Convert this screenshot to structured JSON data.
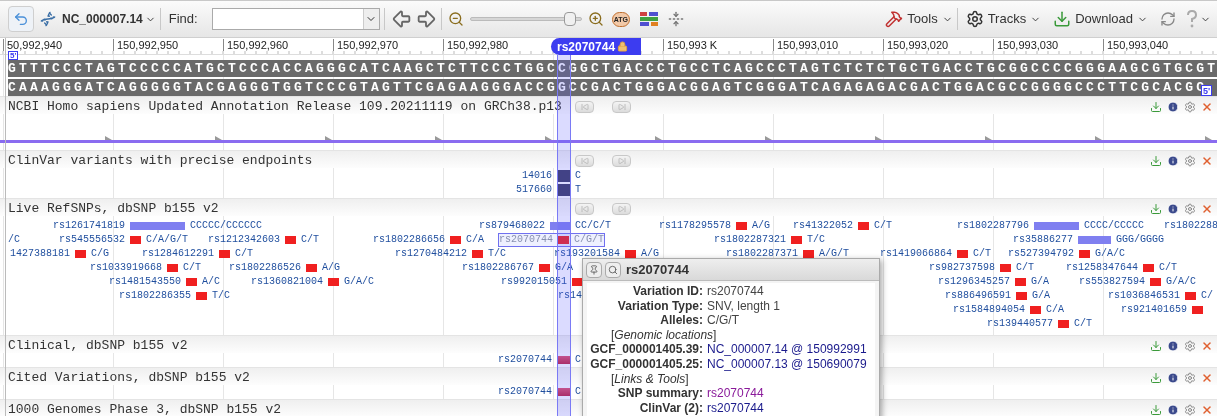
{
  "toolbar": {
    "sequence": "NC_000007.14",
    "find_label": "Find:",
    "level": 0.9,
    "sequence_button": "ATG",
    "menus": [
      "Tools",
      "Tracks",
      "Download"
    ]
  },
  "ruler": {
    "ticks": [
      "50,992,940",
      "150,992,950",
      "150,992,960",
      "150,992,970",
      "150,992,980",
      "150,993 K",
      "150,993,010",
      "150,993,020",
      "150,993,030",
      "150,993,040"
    ],
    "marker": "rs2070744"
  },
  "sequence": {
    "start_label": "5'",
    "forward": "GTTTCCCTAGTCCCCCATGCTCCCACCAGGGCATCAAGCTCTTCCCTGGCCGGCTGACCCTGCCTCAGCCCTAGTCTCTCTGCTGACCTGCGGCCCCGGGAAGCGTGCGT",
    "reverse": "CAAAGGGATCAGGGGGTACGAGGGTGGTCCCGTAGTTCGAGAAGGGACCGGCCGACTGGGACGGAGTCGGGATCAGAGAGACGACTGGACGCCGGGGCCCTTCGCACGC",
    "end_label": "5'"
  },
  "tracks": [
    {
      "kind": "gene",
      "title": "NCBI Homo sapiens Updated Annotation Release 109.20211119 on GRCh38.p13"
    },
    {
      "kind": "clinvar",
      "title": "ClinVar variants with precise endpoints",
      "features": [
        {
          "label": "14016",
          "allele": "C"
        },
        {
          "label": "517660",
          "allele": "T"
        }
      ]
    },
    {
      "kind": "snps",
      "title": "Live RefSNPs, dbSNP b155 v2",
      "lanes": [
        [
          {
            "kind": "indel",
            "label": "rs1261741819",
            "allele": "CCCCC/CCCCCC",
            "selected": false
          },
          {
            "kind": "indel",
            "label": "rs879468022",
            "allele": "CC/C/T",
            "selected": false
          },
          {
            "kind": "snv",
            "label": "rs1178295578",
            "allele": "A/G",
            "selected": false
          },
          {
            "kind": "snv",
            "label": "rs41322052",
            "allele": "C/T",
            "selected": false
          },
          {
            "kind": "indel",
            "label": "rs1802287796",
            "allele": "CCCC/CCCCC",
            "selected": false
          },
          {
            "kind": "label",
            "label": "rs1802288"
          }
        ],
        [
          {
            "kind": "allele",
            "allele": "/C"
          },
          {
            "kind": "snv",
            "label": "rs545556532",
            "allele": "C/A/G/T",
            "selected": false
          },
          {
            "kind": "snv",
            "label": "rs1212342603",
            "allele": "C/T",
            "selected": false
          },
          {
            "kind": "snv",
            "label": "rs1802286656",
            "allele": "C/A",
            "selected": false
          },
          {
            "kind": "snv",
            "label": "rs2070744",
            "allele": "C/G/T",
            "selected": true
          },
          {
            "kind": "snv",
            "label": "rs1802287321",
            "allele": "T/C",
            "selected": false
          },
          {
            "kind": "indel",
            "label": "rs35886277",
            "allele": "GGG/GGGG",
            "selected": false
          }
        ],
        [
          {
            "kind": "snv",
            "label": "1427388181",
            "allele": "C/G",
            "selected": false
          },
          {
            "kind": "snv",
            "label": "rs1284612291",
            "allele": "C/T",
            "selected": false
          },
          {
            "kind": "snv",
            "label": "rs1270484212",
            "allele": "T/C",
            "selected": false
          },
          {
            "kind": "snv",
            "label": "rs193201584",
            "allele": "A/G",
            "selected": false
          },
          {
            "kind": "snv",
            "label": "rs1802287371",
            "allele": "A/G/T",
            "selected": false
          },
          {
            "kind": "snv",
            "label": "rs1419066864",
            "allele": "C/T",
            "selected": false
          },
          {
            "kind": "snv",
            "label": "rs527394792",
            "allele": "G/A/C",
            "selected": false
          }
        ],
        [
          {
            "kind": "snv",
            "label": "rs1033919668",
            "allele": "C/T",
            "selected": false
          },
          {
            "kind": "snv",
            "label": "rs1802286526",
            "allele": "A/G",
            "selected": false
          },
          {
            "kind": "snv",
            "label": "rs1802286767",
            "allele": "G/A",
            "selected": false
          },
          {
            "kind": "snv",
            "label": "rs982737598",
            "allele": "C/T",
            "selected": false
          },
          {
            "kind": "snv",
            "label": "rs1258347644",
            "allele": "C/T",
            "selected": false
          }
        ],
        [
          {
            "kind": "snv",
            "label": "rs1481543550",
            "allele": "A/C",
            "selected": false
          },
          {
            "kind": "snv",
            "label": "rs1360821004",
            "allele": "G/A/C",
            "selected": false
          },
          {
            "kind": "snv",
            "label": "rs992015051",
            "selected": false
          },
          {
            "kind": "snv",
            "label": "rs1296345257",
            "allele": "G/A",
            "selected": false
          },
          {
            "kind": "snv",
            "label": "rs553827594",
            "allele": "G/A/C",
            "selected": false
          }
        ],
        [
          {
            "kind": "snv",
            "label": "rs1802286355",
            "allele": "T/C",
            "selected": false
          },
          {
            "kind": "label",
            "label": "rs14"
          },
          {
            "kind": "snv",
            "label": "rs886496591",
            "allele": "G/A",
            "selected": false
          },
          {
            "kind": "snv",
            "label": "rs1036846531",
            "allele": "C/",
            "selected": false
          }
        ],
        [
          {
            "kind": "snv",
            "label": "rs1584894054",
            "allele": "C/A",
            "selected": false
          },
          {
            "kind": "snv",
            "label": "rs921401659",
            "selected": false
          }
        ],
        [
          {
            "kind": "snv",
            "label": "rs139440577",
            "allele": "C/T",
            "selected": false
          }
        ]
      ]
    },
    {
      "kind": "marker",
      "title": "Clinical, dbSNP b155 v2",
      "features": [
        {
          "label": "rs2070744",
          "allele": "C"
        }
      ]
    },
    {
      "kind": "marker",
      "title": "Cited Variations, dbSNP b155 v2",
      "features": [
        {
          "label": "rs2070744",
          "allele": "C"
        }
      ]
    },
    {
      "kind": "empty",
      "title": "1000 Genomes Phase 3, dbSNP b155 v2"
    }
  ],
  "popup": {
    "title": "rs2070744",
    "rows": [
      {
        "kind": "field",
        "label": "Variation ID:",
        "value": "rs2070744"
      },
      {
        "kind": "field",
        "label": "Variation Type:",
        "value": "SNV, length 1"
      },
      {
        "kind": "field",
        "label": "Alleles:",
        "value": "C/G/T"
      },
      {
        "kind": "section",
        "text": "[*Genomic locations*]"
      },
      {
        "kind": "link",
        "label": "GCF_000001405.39:",
        "value": "NC_000007.14 @ 150992991"
      },
      {
        "kind": "link",
        "label": "GCF_000001405.25:",
        "value": "NC_000007.13 @ 150690079"
      },
      {
        "kind": "section",
        "text": "[*Links & Tools*]"
      },
      {
        "kind": "visited",
        "label": "SNP summary:",
        "value": "rs2070744"
      },
      {
        "kind": "link",
        "label": "ClinVar (2):",
        "value": "rs2070744"
      }
    ]
  }
}
